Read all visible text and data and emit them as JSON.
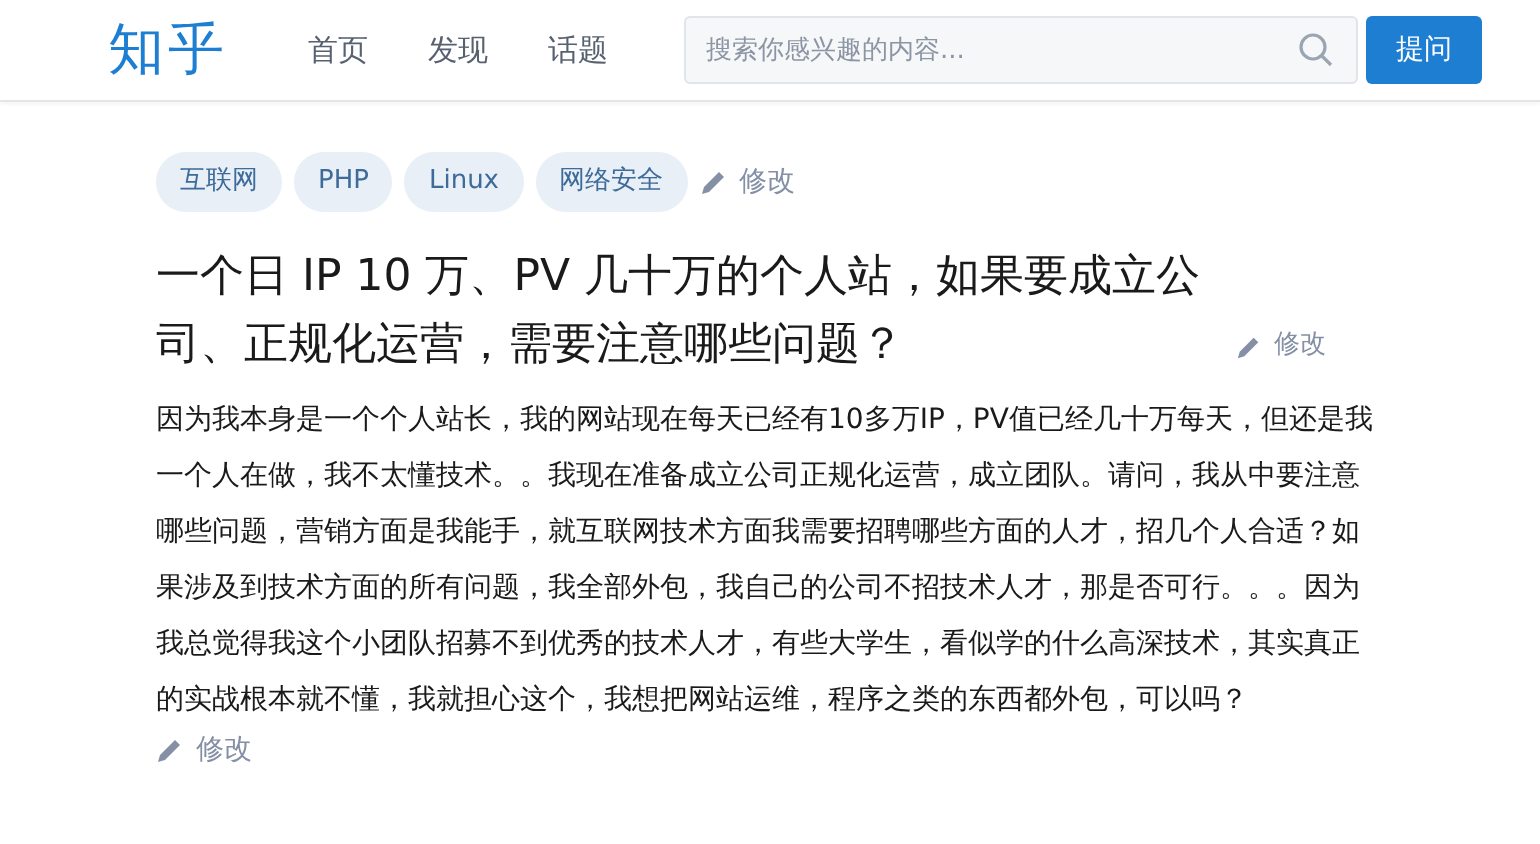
{
  "header": {
    "logo": "知乎",
    "nav": [
      {
        "label": "首页"
      },
      {
        "label": "发现"
      },
      {
        "label": "话题"
      }
    ],
    "search": {
      "placeholder": "搜索你感兴趣的内容..."
    },
    "ask_button": "提问"
  },
  "topics": {
    "tags": [
      "互联网",
      "PHP",
      "Linux",
      "网络安全"
    ],
    "edit": "修改"
  },
  "question": {
    "title": "一个日 IP 10 万、PV 几十万的个人站，如果要成立公司、正规化运营，需要注意哪些问题？",
    "title_edit": "修改",
    "body": "因为我本身是一个个人站长，我的网站现在每天已经有10多万IP，PV值已经几十万每天，但还是我一个人在做，我不太懂技术。。我现在准备成立公司正规化运营，成立团队。请问，我从中要注意哪些问题，营销方面是我能手，就互联网技术方面我需要招聘哪些方面的人才，招几个人合适？如果涉及到技术方面的所有问题，我全部外包，我自己的公司不招技术人才，那是否可行。。。因为我总觉得我这个小团队招募不到优秀的技术人才，有些大学生，看似学的什么高深技术，其实真正的实战根本就不懂，我就担心这个，我想把网站运维，程序之类的东西都外包，可以吗？",
    "body_edit": "修改"
  }
}
